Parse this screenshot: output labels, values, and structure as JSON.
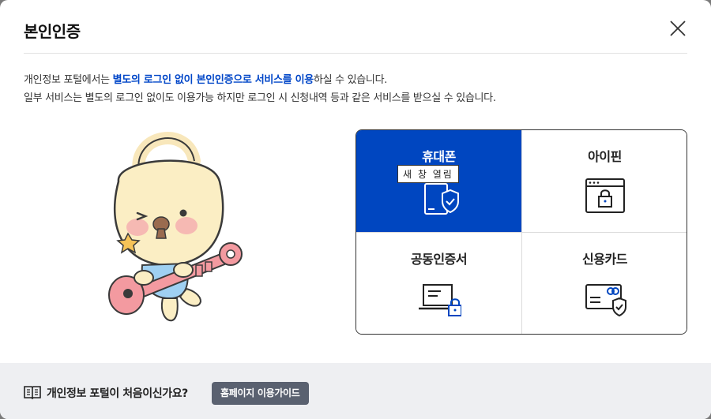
{
  "dialog": {
    "title": "본인인증"
  },
  "description": {
    "line1_pre": "개인정보 포털에서는 ",
    "line1_highlight": "별도의 로그인 없이 본인인증으로 서비스를 이용",
    "line1_post": "하실 수 있습니다.",
    "line2": "일부 서비스는 별도의 로그인 없이도 이용가능 하지만 로그인 시 신청내역 등과 같은 서비스를 받으실 수 있습니다."
  },
  "methods": [
    {
      "label": "휴대폰",
      "icon": "mobile-shield-icon",
      "active": true,
      "tooltip": "새 창 열림"
    },
    {
      "label": "아이핀",
      "icon": "browser-lock-icon",
      "active": false
    },
    {
      "label": "공동인증서",
      "icon": "laptop-lock-icon",
      "active": false
    },
    {
      "label": "신용카드",
      "icon": "card-shield-icon",
      "active": false
    }
  ],
  "footer": {
    "question": "개인정보 포털이 처음이신가요?",
    "guide_button": "홈페이지 이용가이드"
  },
  "colors": {
    "accent": "#0046c0",
    "highlight_text": "#0046c8",
    "footer_bg": "#eeeff2",
    "guide_button_bg": "#5a6170"
  }
}
